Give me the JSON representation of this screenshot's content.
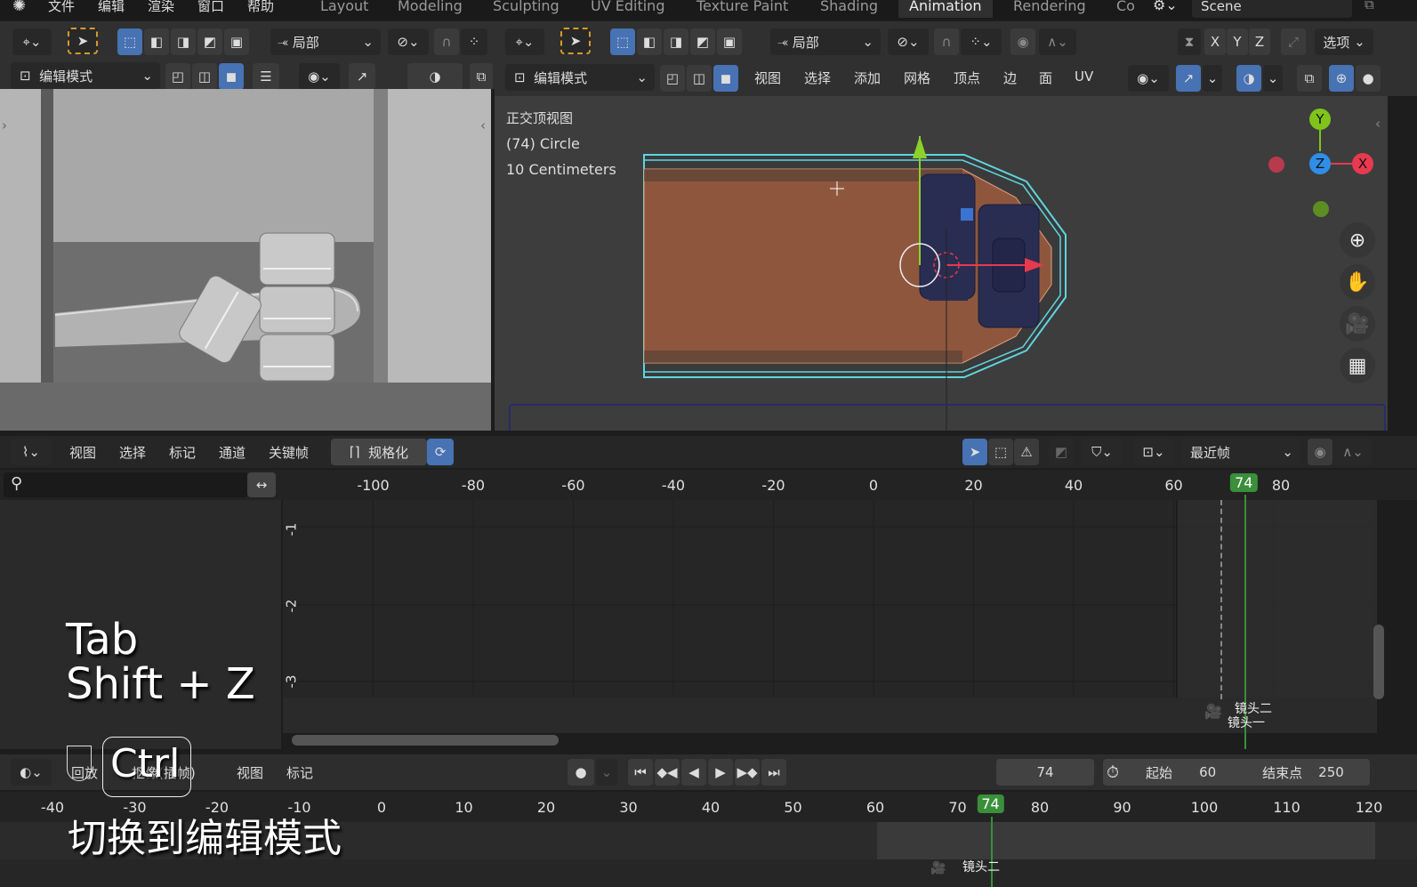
{
  "menu": {
    "logo_icon": "blender-logo-icon",
    "items": [
      "文件",
      "编辑",
      "渲染",
      "窗口",
      "帮助"
    ]
  },
  "workspaces": {
    "tabs": [
      "Layout",
      "Modeling",
      "Sculpting",
      "UV Editing",
      "Texture Paint",
      "Shading",
      "Animation",
      "Rendering",
      "Co"
    ],
    "active": "Animation"
  },
  "scene": {
    "name": "Scene"
  },
  "left_viewport": {
    "transform_orientation": "局部",
    "mode": "编辑模式"
  },
  "right_viewport": {
    "transform_orientation": "局部",
    "mode": "编辑模式",
    "menus": [
      "视图",
      "选择",
      "添加",
      "网格",
      "顶点",
      "边",
      "面",
      "UV"
    ],
    "axes": [
      "X",
      "Y",
      "Z"
    ],
    "options_label": "选项",
    "info": {
      "view_name": "正交顶视图",
      "object": "(74) Circle",
      "scale": "10 Centimeters"
    },
    "gizmo": {
      "x": "X",
      "y": "Y",
      "z": "Z",
      "colors": {
        "x": "#e8394e",
        "y": "#7fc41b",
        "z": "#2f8ee8"
      }
    },
    "face_color": "#8e573d",
    "edge_color": "#5fd5e0"
  },
  "graph_editor": {
    "menus": [
      "视图",
      "选择",
      "标记",
      "通道",
      "关键帧"
    ],
    "normalize_label": "规格化",
    "pivot": "最近帧",
    "search_placeholder": "",
    "ruler": [
      "-100",
      "-80",
      "-60",
      "-40",
      "-20",
      "0",
      "20",
      "40",
      "60",
      "80"
    ],
    "current_frame": "74",
    "y_ticks": [
      "-1",
      "-2",
      "-3"
    ],
    "markers": [
      "镜头二",
      "镜头一"
    ]
  },
  "timeline": {
    "menus": [
      "回放",
      "抠像(插帧)",
      "视图",
      "标记"
    ],
    "current_frame": "74",
    "start_label": "起始",
    "start": "60",
    "end_label": "结束点",
    "end": "250",
    "ruler": [
      "-40",
      "-30",
      "-20",
      "-10",
      "0",
      "10",
      "20",
      "30",
      "40",
      "50",
      "60",
      "70",
      "80",
      "90",
      "100",
      "110",
      "120"
    ],
    "marker": "镜头二"
  },
  "overlay": {
    "keys_line1": "Tab",
    "keys_line2": "Shift + Z",
    "ctrl_key": "Ctrl",
    "subtitle": "切换到编辑模式"
  },
  "accent": "#4772b3",
  "frame_color": "#3a8f3a"
}
